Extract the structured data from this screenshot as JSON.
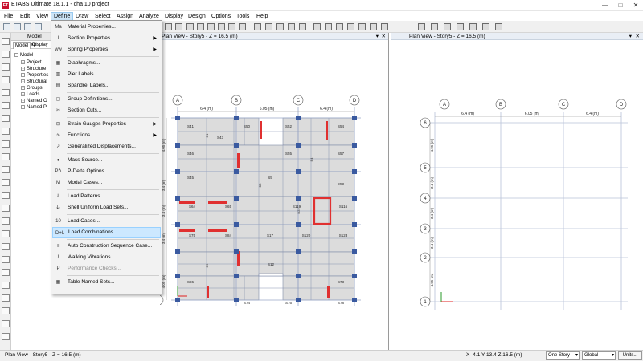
{
  "window": {
    "title": "ETABS Ultimate 18.1.1 - cha 10 project",
    "logo_text": "ET",
    "controls": [
      "—",
      "□",
      "✕"
    ]
  },
  "menubar": {
    "items": [
      "File",
      "Edit",
      "View",
      "Define",
      "Draw",
      "Select",
      "Assign",
      "Analyze",
      "Display",
      "Design",
      "Options",
      "Tools",
      "Help"
    ],
    "active": "Define"
  },
  "explorer": {
    "header": "Model Exp",
    "tabs": [
      "Model",
      "Display"
    ],
    "tree": [
      "Model",
      "Project",
      "Structure",
      "Properties",
      "Structural",
      "Groups",
      "Loads",
      "Named O",
      "Named Pl"
    ]
  },
  "define_menu": {
    "items": [
      {
        "label": "Material Properties...",
        "icon": "Ma",
        "submenu": false,
        "disabled": false,
        "highlighted": false
      },
      {
        "label": "Section Properties",
        "icon": "I",
        "submenu": true,
        "disabled": false,
        "highlighted": false
      },
      {
        "label": "Spring Properties",
        "icon": "ww",
        "submenu": true,
        "disabled": false,
        "highlighted": false
      },
      {
        "label": "Diaphragms...",
        "icon": "▦",
        "submenu": false,
        "disabled": false,
        "highlighted": false
      },
      {
        "label": "Pier Labels...",
        "icon": "▥",
        "submenu": false,
        "disabled": false,
        "highlighted": false
      },
      {
        "label": "Spandrel Labels...",
        "icon": "▤",
        "submenu": false,
        "disabled": false,
        "highlighted": false
      },
      {
        "label": "Group Definitions...",
        "icon": "▢",
        "submenu": false,
        "disabled": false,
        "highlighted": false
      },
      {
        "label": "Section Cuts...",
        "icon": "✂",
        "submenu": false,
        "disabled": false,
        "highlighted": false
      },
      {
        "label": "Strain Gauges Properties",
        "icon": "⊟",
        "submenu": true,
        "disabled": false,
        "highlighted": false
      },
      {
        "label": "Functions",
        "icon": "∿",
        "submenu": true,
        "disabled": false,
        "highlighted": false
      },
      {
        "label": "Generalized Displacements...",
        "icon": "↗",
        "submenu": false,
        "disabled": false,
        "highlighted": false
      },
      {
        "label": "Mass Source...",
        "icon": "●",
        "submenu": false,
        "disabled": false,
        "highlighted": false
      },
      {
        "label": "P-Delta Options...",
        "icon": "PΔ",
        "submenu": false,
        "disabled": false,
        "highlighted": false
      },
      {
        "label": "Modal Cases...",
        "icon": "M",
        "submenu": false,
        "disabled": false,
        "highlighted": false
      },
      {
        "label": "Load Patterns...",
        "icon": "⇓",
        "submenu": false,
        "disabled": false,
        "highlighted": false
      },
      {
        "label": "Shell Uniform Load Sets...",
        "icon": "⇊",
        "submenu": false,
        "disabled": false,
        "highlighted": false
      },
      {
        "label": "Load Cases...",
        "icon": "10",
        "submenu": false,
        "disabled": false,
        "highlighted": false
      },
      {
        "label": "Load Combinations...",
        "icon": "D+L",
        "submenu": false,
        "disabled": false,
        "highlighted": true
      },
      {
        "label": "Auto Construction Sequence Case...",
        "icon": "≡",
        "submenu": false,
        "disabled": false,
        "highlighted": false
      },
      {
        "label": "Walking Vibrations...",
        "icon": "⌇",
        "submenu": false,
        "disabled": false,
        "highlighted": false
      },
      {
        "label": "Performance Checks...",
        "icon": "P",
        "submenu": false,
        "disabled": true,
        "highlighted": false
      },
      {
        "label": "Table Named Sets...",
        "icon": "▦",
        "submenu": false,
        "disabled": false,
        "highlighted": false
      }
    ]
  },
  "view1": {
    "title": "Plan View - Story5 - Z = 16.5 (m)",
    "grid_x_labels": [
      "A",
      "B",
      "C",
      "D"
    ],
    "dims_top": [
      "6.4 (m)",
      "6.05 (m)",
      "6.4 (m)"
    ],
    "dims_left": [
      "4.05 (m)",
      "3.4 (m)",
      "3.4 (m)",
      "3.4 (m)",
      "4.05 (m)"
    ],
    "axis_y_label": "1",
    "slab_labels": [
      "S41",
      "S50",
      "S52",
      "S54",
      "S43",
      "S46",
      "S55",
      "S57",
      "S45",
      "S5",
      "S58",
      "S64",
      "S65",
      "S119",
      "S116",
      "S75",
      "S84",
      "S17",
      "S120",
      "S123",
      "S12",
      "S86",
      "S73",
      "S74",
      "S76",
      "S78"
    ],
    "beam_labels": [
      "B1",
      "B3",
      "B4",
      "B22",
      "B9"
    ]
  },
  "view2": {
    "title": "Plan View - Story5 - Z = 16.5 (m)",
    "grid_x_labels": [
      "A",
      "B",
      "C",
      "D"
    ],
    "grid_y_labels": [
      "6",
      "5",
      "4",
      "3",
      "2",
      "1"
    ],
    "dims_top": [
      "6.4 (m)",
      "6.05 (m)",
      "6.4 (m)"
    ],
    "dims_left": [
      "4.05 (m)",
      "3.4 (m)",
      "3.4 (m)",
      "3.4 (m)",
      "4.05 (m)"
    ]
  },
  "statusbar": {
    "left": "Plan View - Story5 - Z = 16.5 (m)",
    "coords": "X -4.1  Y 13.4  Z 16.5 (m)",
    "story_select": "One Story",
    "coord_system": "Global",
    "units_button": "Units..."
  },
  "colors": {
    "menu_highlight": "#cce8ff",
    "slab_fill": "#dcdcdc",
    "grid_line": "#9aa8c8",
    "wall_red": "#e03030",
    "column_blue": "#3a5aa0"
  }
}
